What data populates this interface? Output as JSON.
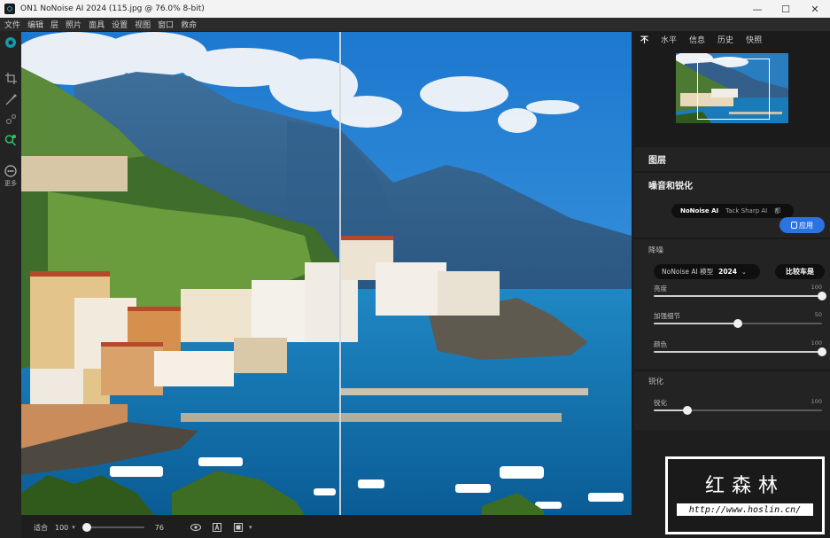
{
  "window": {
    "title": "ON1 NoNoise AI 2024 (115.jpg @ 76.0% 8-bit)",
    "minimize": "—",
    "maximize": "☐",
    "close": "✕"
  },
  "menu": [
    "文件",
    "编辑",
    "层",
    "照片",
    "面具",
    "设置",
    "视图",
    "窗口",
    "救命"
  ],
  "left_tools": {
    "more_label": "更多"
  },
  "bottom_bar": {
    "fit_label": "适合",
    "zoom_value": "100",
    "zoom_slider_value": "76",
    "zoom_slider_fraction": 0.08
  },
  "right_panel": {
    "tabs": [
      "不",
      "水平",
      "信息",
      "历史",
      "快照"
    ],
    "layers_title": "图层",
    "noise_title": "噪音和锐化",
    "segments": [
      "NoNoise AI",
      "Tack Sharp AI",
      "都"
    ],
    "apply_label": "应用",
    "denoise_title": "降噪",
    "model_label": "NoNoise AI 模型",
    "model_version": "2024",
    "compare_label": "比较车是",
    "sliders": [
      {
        "label": "亮度",
        "value": "100",
        "fraction": 1.0
      },
      {
        "label": "加强细节",
        "value": "50",
        "fraction": 0.5
      },
      {
        "label": "颜色",
        "value": "100",
        "fraction": 1.0
      }
    ],
    "sharpen_title": "锐化",
    "sharpen_sliders": [
      {
        "label": "锐化",
        "value": "100",
        "fraction": 0.2
      }
    ]
  },
  "watermark": {
    "title": "红森林",
    "url": "http://www.hoslin.cn/"
  },
  "colors": {
    "accent": "#2b73e0",
    "ok": "#2fb34a",
    "cancel": "#7a7a7a"
  }
}
